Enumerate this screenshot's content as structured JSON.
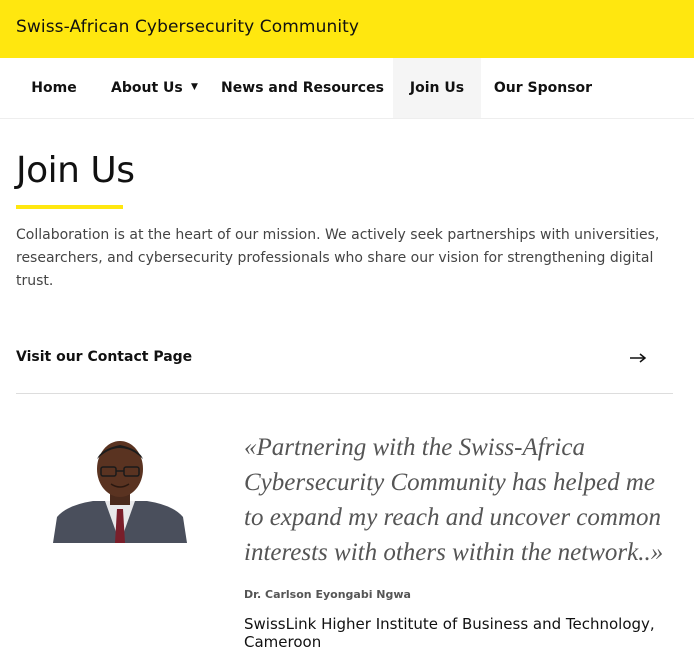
{
  "header": {
    "site_title": "Swiss-African Cybersecurity Community"
  },
  "nav": {
    "items": [
      {
        "label": "Home"
      },
      {
        "label": "About Us"
      },
      {
        "label": "News and Resources"
      },
      {
        "label": "Join Us"
      },
      {
        "label": "Our Sponsor"
      }
    ],
    "active": "Join Us",
    "dropdown_caret": "▼"
  },
  "main": {
    "title": "Join Us",
    "intro": "Collaboration is at the heart of our mission. We actively seek partnerships with universities, researchers, and cybersecurity professionals who share our vision for strengthening digital trust.",
    "contact_link_label": "Visit our Contact Page",
    "contact_link_icon": "arrow-right-icon"
  },
  "testimonial": {
    "quote": "«Partnering with the Swiss-Africa Cybersecurity Community has helped me to expand my reach and uncover common interests with others within the network..»",
    "author": "Dr. Carlson Eyongabi Ngwa",
    "organization": "SwissLink Higher Institute of Business and Technology, Cameroon"
  },
  "colors": {
    "accent": "#FFE70F",
    "text": "#111111",
    "muted": "#555555"
  }
}
